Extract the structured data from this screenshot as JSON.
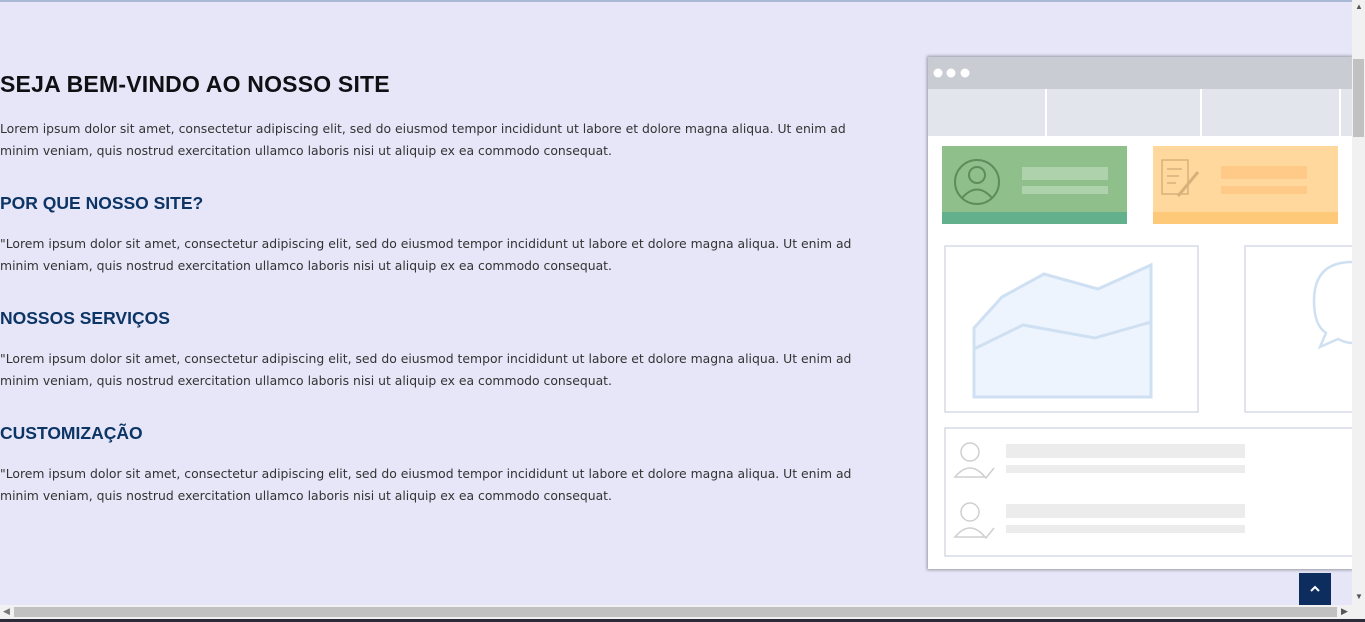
{
  "main": {
    "title": "SEJA BEM-VINDO AO NOSSO SITE",
    "intro": "Lorem ipsum dolor sit amet, consectetur adipiscing elit, sed do eiusmod tempor incididunt ut labore et dolore magna aliqua. Ut enim ad minim veniam, quis nostrud exercitation ullamco laboris nisi ut aliquip ex ea commodo consequat.",
    "sections": [
      {
        "heading": "POR QUE NOSSO SITE?",
        "text": "\"Lorem ipsum dolor sit amet, consectetur adipiscing elit, sed do eiusmod tempor incididunt ut labore et dolore magna aliqua. Ut enim ad minim veniam, quis nostrud exercitation ullamco laboris nisi ut aliquip ex ea commodo consequat."
      },
      {
        "heading": "NOSSOS SERVIÇOS",
        "text": "\"Lorem ipsum dolor sit amet, consectetur adipiscing elit, sed do eiusmod tempor incididunt ut labore et dolore magna aliqua. Ut enim ad minim veniam, quis nostrud exercitation ullamco laboris nisi ut aliquip ex ea commodo consequat."
      },
      {
        "heading": "CUSTOMIZAÇÃO",
        "text": "\"Lorem ipsum dolor sit amet, consectetur adipiscing elit, sed do eiusmod tempor incididunt ut labore et dolore magna aliqua. Ut enim ad minim veniam, quis nostrud exercitation ullamco laboris nisi ut aliquip ex ea commodo consequat."
      }
    ]
  },
  "illustration": {
    "icons": [
      "browser-mockup-illustration",
      "user-icon",
      "document-edit-icon",
      "area-chart",
      "chat-bubble-icon",
      "person-check-icon"
    ]
  },
  "colors": {
    "background": "#e6e6f8",
    "heading": "#0c3566",
    "back_to_top": "#0d2d5e"
  },
  "controls": {
    "back_to_top_icon": "chevron-up-icon"
  }
}
